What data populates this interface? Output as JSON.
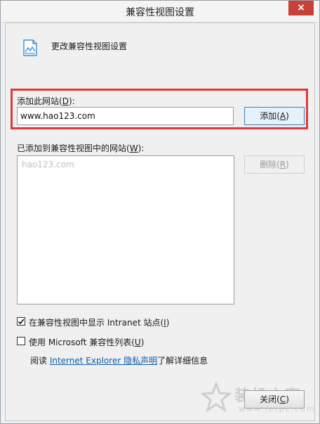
{
  "window": {
    "title": "兼容性视图设置",
    "close_glyph": "×"
  },
  "header": {
    "icon": "page-compatibility-icon",
    "text": "更改兼容性视图设置"
  },
  "add_site": {
    "label": "添加此网站(",
    "label_key": "D",
    "label_tail": "):",
    "input_value": "www.hao123.com",
    "add_button": "添加(",
    "add_button_key": "A",
    "add_button_tail": ")"
  },
  "added_sites": {
    "label": "已添加到兼容性视图中的网站(",
    "label_key": "W",
    "label_tail": "):",
    "items": [
      "hao123.com"
    ],
    "remove_button": "删除(",
    "remove_button_key": "R",
    "remove_button_tail": ")"
  },
  "options": {
    "intranet": {
      "label": "在兼容性视图中显示 Intranet 站点(",
      "key": "I",
      "tail": ")",
      "checked": true
    },
    "ms_list": {
      "label": "使用 Microsoft 兼容性列表(",
      "key": "U",
      "tail": ")",
      "checked": false
    }
  },
  "privacy": {
    "prefix": "阅读 ",
    "link": "Internet Explorer 隐私声明",
    "suffix": "了解详细信息"
  },
  "footer": {
    "close_button": "关闭(",
    "close_key": "C",
    "close_tail": ")"
  },
  "watermark": {
    "big": "装机之家",
    "small": "www.lotpc.com"
  }
}
